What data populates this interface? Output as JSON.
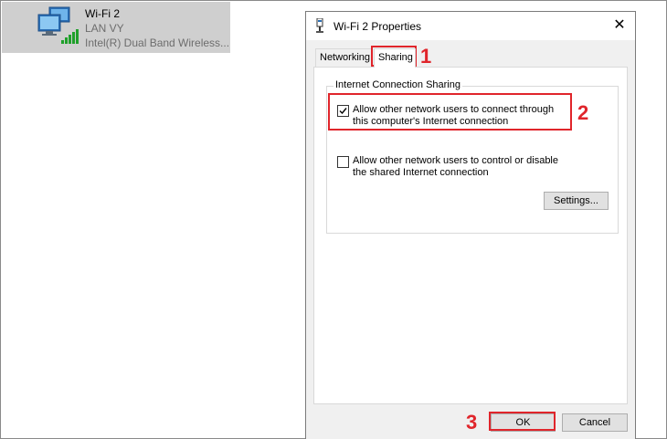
{
  "adapter": {
    "name": "Wi-Fi 2",
    "network": "LAN VY",
    "device": "Intel(R) Dual Band Wireless..."
  },
  "dialog": {
    "title": "Wi-Fi 2 Properties",
    "close_symbol": "✕",
    "tabs": [
      "Networking",
      "Sharing"
    ],
    "active_tab": "Sharing",
    "group_title": "Internet Connection Sharing",
    "options": [
      {
        "label": "Allow other network users to connect through this computer's Internet connection",
        "checked": true
      },
      {
        "label": "Allow other network users to control or disable the shared Internet connection",
        "checked": false
      }
    ],
    "settings_button": "Settings...",
    "ok_button": "OK",
    "cancel_button": "Cancel"
  },
  "annotations": {
    "step1": "1",
    "step2": "2",
    "step3": "3",
    "color": "#e0252b"
  },
  "icons": {
    "adapter": "wireless-network-adapter-icon",
    "title": "network-adapter-icon"
  }
}
